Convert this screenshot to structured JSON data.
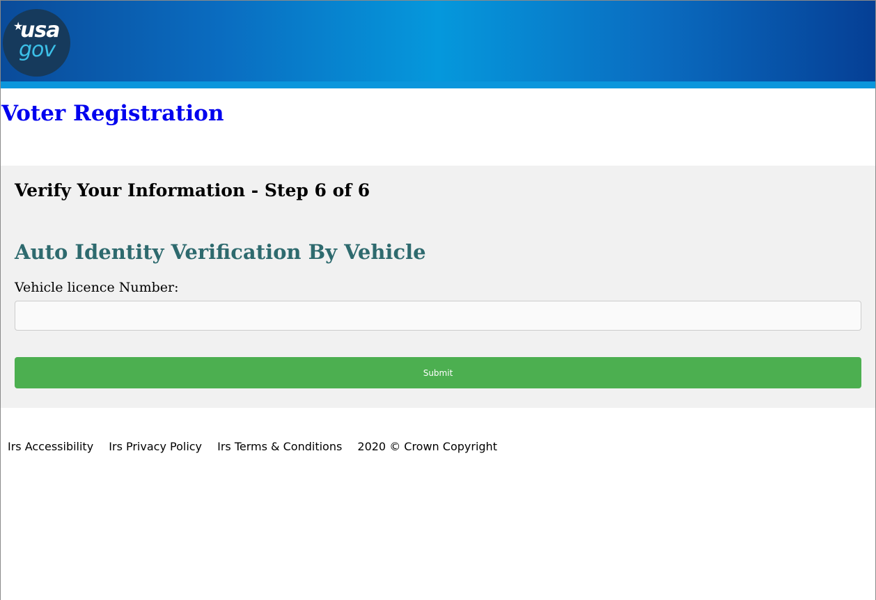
{
  "header": {
    "logo": {
      "star": "★",
      "line1": "usa",
      "line2": "gov"
    },
    "colors": {
      "band_edge": "#0a4b9a",
      "band_center": "#0598dc",
      "stripe": "#0b96dc",
      "logo_bg": "#163a5c",
      "logo_gov": "#3cc0e8"
    }
  },
  "page": {
    "title": "Voter Registration",
    "title_color": "#0000ee"
  },
  "form": {
    "step_title": "Verify Your Information - Step 6 of 6",
    "section_title": "Auto Identity Verification By Vehicle",
    "section_title_color": "#2e6a6e",
    "vehicle_label": "Vehicle licence Number:",
    "vehicle_value": "",
    "vehicle_placeholder": "",
    "submit_label": "Submit",
    "submit_color": "#4caf50"
  },
  "footer": {
    "links": [
      "Irs Accessibility",
      "Irs Privacy Policy",
      "Irs Terms & Conditions"
    ],
    "copyright": "2020 © Crown Copyright"
  }
}
